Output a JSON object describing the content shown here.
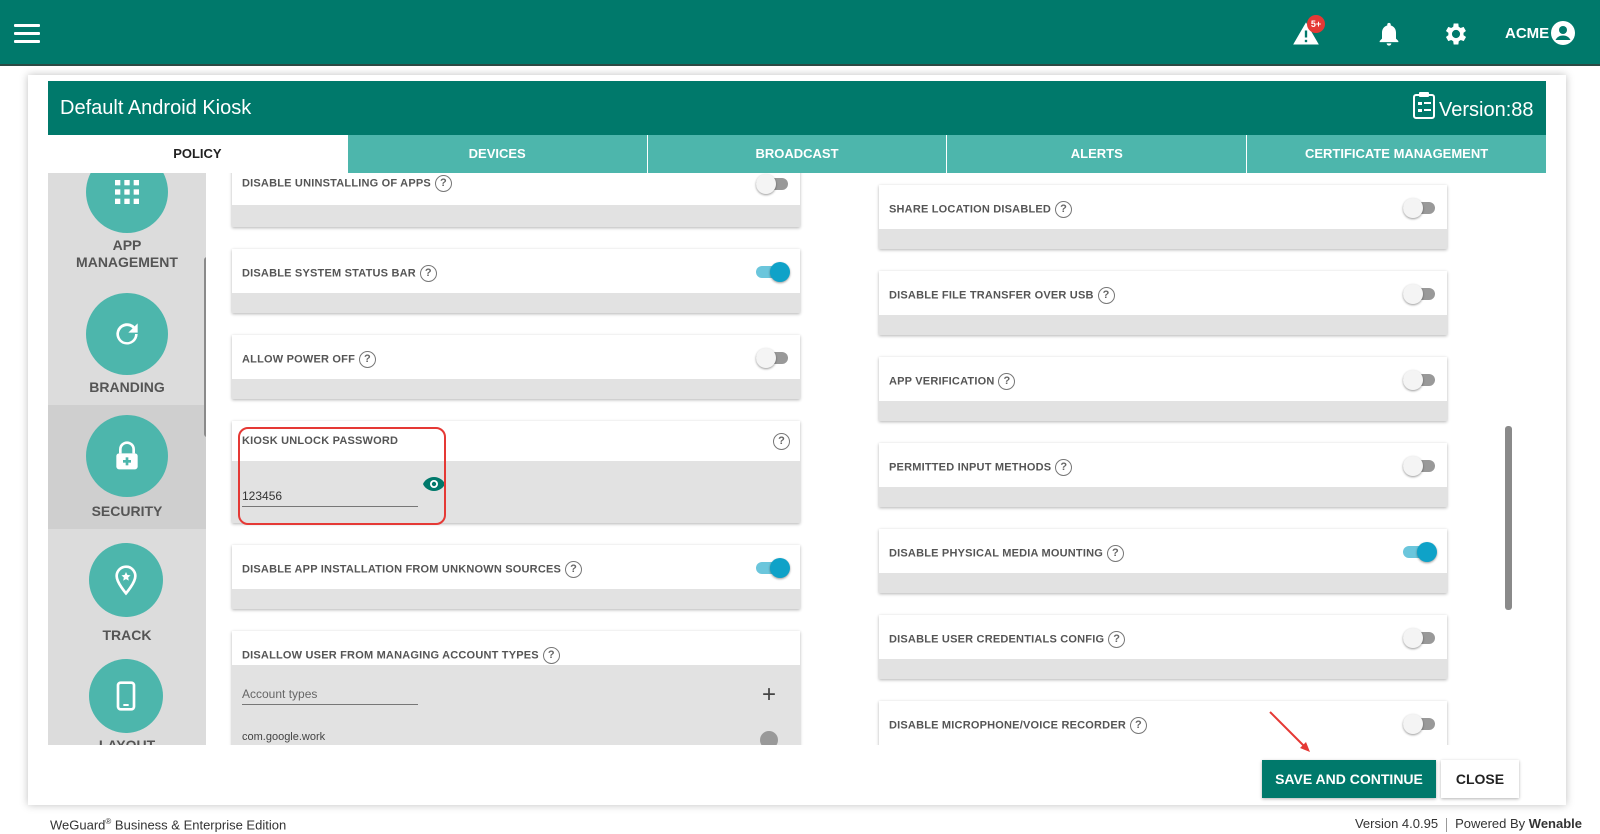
{
  "topbar": {
    "alert_badge": "5+",
    "user_name": "ACME"
  },
  "header": {
    "title": "Default Android Kiosk",
    "version": "Version:88"
  },
  "tabs": [
    {
      "label": "POLICY",
      "active": true
    },
    {
      "label": "DEVICES",
      "active": false
    },
    {
      "label": "BROADCAST",
      "active": false
    },
    {
      "label": "ALERTS",
      "active": false
    },
    {
      "label": "CERTIFICATE MANAGEMENT",
      "active": false
    }
  ],
  "sidebar": {
    "items": [
      {
        "label_line1": "APP",
        "label_line2": "MANAGEMENT",
        "icon": "grid-icon"
      },
      {
        "label": "BRANDING",
        "icon": "refresh-icon"
      },
      {
        "label": "SECURITY",
        "icon": "lock-icon",
        "selected": true
      },
      {
        "label": "TRACK",
        "icon": "location-pin-icon"
      },
      {
        "label": "LAYOUT",
        "icon": "phone-icon"
      }
    ]
  },
  "left_settings": {
    "disable_uninstalling": {
      "label": "DISABLE UNINSTALLING OF APPS",
      "enabled": false
    },
    "disable_status_bar": {
      "label": "DISABLE SYSTEM STATUS BAR",
      "enabled": true
    },
    "allow_power_off": {
      "label": "ALLOW POWER OFF",
      "enabled": false
    },
    "kiosk_unlock": {
      "label": "KIOSK UNLOCK PASSWORD",
      "value": "123456"
    },
    "unknown_sources": {
      "label": "DISABLE APP INSTALLATION FROM UNKNOWN SOURCES",
      "enabled": true
    },
    "account_types": {
      "label": "DISALLOW USER FROM MANAGING ACCOUNT TYPES",
      "placeholder": "Account types",
      "items": [
        "com.google.work"
      ]
    }
  },
  "right_settings": {
    "share_location": {
      "label": "SHARE LOCATION DISABLED",
      "enabled": false
    },
    "file_transfer": {
      "label": "DISABLE FILE TRANSFER OVER USB",
      "enabled": false
    },
    "app_verification": {
      "label": "APP VERIFICATION",
      "enabled": false
    },
    "input_methods": {
      "label": "PERMITTED INPUT METHODS",
      "enabled": false
    },
    "media_mounting": {
      "label": "DISABLE PHYSICAL MEDIA MOUNTING",
      "enabled": true
    },
    "user_credentials": {
      "label": "DISABLE USER CREDENTIALS CONFIG",
      "enabled": false
    },
    "microphone": {
      "label": "DISABLE MICROPHONE/VOICE RECORDER",
      "enabled": false
    }
  },
  "help_glyph": "?",
  "buttons": {
    "save": "SAVE AND CONTINUE",
    "close": "CLOSE"
  },
  "footer": {
    "brand": "WeGuard",
    "registered": "®",
    "edition": " Business & Enterprise Edition",
    "version": "Version 4.0.95",
    "powered_by": "Powered By ",
    "company": "Wenable"
  },
  "colors": {
    "primary": "#00796b",
    "tab_inactive": "#4db6ac",
    "toggle_on": "#0fa2c8",
    "highlight": "#e53935"
  }
}
